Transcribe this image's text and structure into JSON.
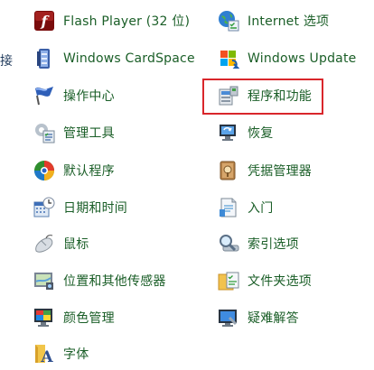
{
  "edge_label": "接",
  "left_items": [
    {
      "label": "Flash Player (32 位)",
      "icon": "flash-player-icon"
    },
    {
      "label": "Windows CardSpace",
      "icon": "cardspace-icon"
    },
    {
      "label": "操作中心",
      "icon": "action-center-flag-icon"
    },
    {
      "label": "管理工具",
      "icon": "admin-tools-icon"
    },
    {
      "label": "默认程序",
      "icon": "default-programs-icon"
    },
    {
      "label": "日期和时间",
      "icon": "date-time-icon"
    },
    {
      "label": "鼠标",
      "icon": "mouse-icon"
    },
    {
      "label": "位置和其他传感器",
      "icon": "location-sensors-icon"
    },
    {
      "label": "颜色管理",
      "icon": "color-management-icon"
    },
    {
      "label": "字体",
      "icon": "fonts-icon"
    }
  ],
  "right_items": [
    {
      "label": "Internet 选项",
      "icon": "internet-options-icon"
    },
    {
      "label": "Windows Update",
      "icon": "windows-update-icon"
    },
    {
      "label": "程序和功能",
      "icon": "programs-features-icon"
    },
    {
      "label": "恢复",
      "icon": "recovery-icon"
    },
    {
      "label": "凭据管理器",
      "icon": "credential-manager-icon"
    },
    {
      "label": "入门",
      "icon": "getting-started-icon"
    },
    {
      "label": "索引选项",
      "icon": "indexing-options-icon"
    },
    {
      "label": "文件夹选项",
      "icon": "folder-options-icon"
    },
    {
      "label": "疑难解答",
      "icon": "troubleshooting-icon"
    }
  ],
  "colors": {
    "link_text": "#1a5e27",
    "highlight_border": "#d9262b"
  }
}
